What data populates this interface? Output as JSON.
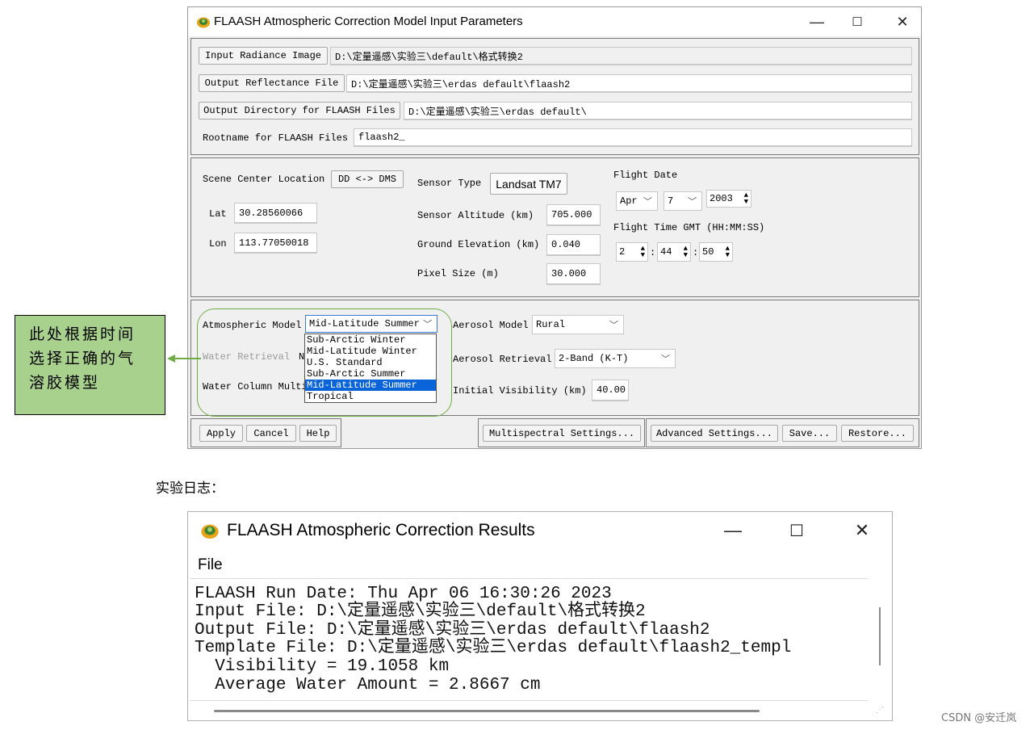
{
  "main_window": {
    "title": "FLAASH Atmospheric Correction Model Input Parameters",
    "controls": {
      "minimize": "—",
      "maximize": "☐",
      "close": "✕"
    },
    "files": {
      "input_radiance_label": "Input Radiance Image",
      "input_radiance_value": "D:\\定量遥感\\实验三\\default\\格式转换2",
      "output_reflectance_label": "Output Reflectance File",
      "output_reflectance_value": "D:\\定量遥感\\实验三\\erdas default\\flaash2",
      "output_directory_label": "Output Directory for FLAASH Files",
      "output_directory_value": "D:\\定量遥感\\实验三\\erdas default\\",
      "rootname_label": "Rootname for FLAASH Files",
      "rootname_value": "flaash2_"
    },
    "scene": {
      "scene_center_label": "Scene Center Location",
      "dd_dms_button": "DD <-> DMS",
      "lat_label": "Lat",
      "lat_value": "30.28560066",
      "lon_label": "Lon",
      "lon_value": "113.77050018",
      "sensor_type_label": "Sensor Type",
      "sensor_type_value": "Landsat TM7",
      "sensor_altitude_label": "Sensor Altitude (km)",
      "sensor_altitude_value": "705.000",
      "ground_elevation_label": "Ground Elevation (km)",
      "ground_elevation_value": "0.040",
      "pixel_size_label": "Pixel Size (m)",
      "pixel_size_value": "30.000",
      "flight_date_label": "Flight Date",
      "month": "Apr",
      "day": "7",
      "year": "2003",
      "flight_time_label": "Flight Time GMT (HH:MM:SS)",
      "hour": "2",
      "minute": "44",
      "second": "50",
      "time_sep": ":"
    },
    "model": {
      "atmospheric_model_label": "Atmospheric Model",
      "atmospheric_model_value": "Mid-Latitude Summer",
      "atmospheric_model_options": [
        "Sub-Arctic Winter",
        "Mid-Latitude Winter",
        "U.S. Standard",
        "Sub-Arctic Summer",
        "Mid-Latitude Summer",
        "Tropical"
      ],
      "selected_index": 4,
      "water_retrieval_label": "Water Retrieval",
      "water_retrieval_value_partial": "N",
      "water_column_label": "Water Column Multi",
      "aerosol_model_label": "Aerosol Model",
      "aerosol_model_value": "Rural",
      "aerosol_retrieval_label": "Aerosol Retrieval",
      "aerosol_retrieval_value": "2-Band (K-T)",
      "initial_visibility_label": "Initial Visibility (km)",
      "initial_visibility_value": "40.00"
    },
    "buttons": {
      "apply": "Apply",
      "cancel": "Cancel",
      "help": "Help",
      "multispectral": "Multispectral Settings...",
      "advanced": "Advanced Settings...",
      "save": "Save...",
      "restore": "Restore..."
    }
  },
  "annotation": {
    "lines": [
      "此处根据时间",
      "选择正确的气",
      "溶胶模型"
    ],
    "color": "#a9d18e",
    "outline_color": "#70ad47"
  },
  "log_heading": "实验日志：",
  "results_window": {
    "title": "FLAASH Atmospheric Correction Results",
    "menu_file": "File",
    "lines": [
      "FLAASH Run Date: Thu Apr 06 16:30:26 2023",
      "Input File: D:\\定量遥感\\实验三\\default\\格式转换2",
      "Output File: D:\\定量遥感\\实验三\\erdas default\\flaash2",
      "Template File: D:\\定量遥感\\实验三\\erdas default\\flaash2_templ",
      "  Visibility = 19.1058 km",
      "  Average Water Amount = 2.8667 cm"
    ]
  },
  "watermark": "CSDN @安迁岚"
}
